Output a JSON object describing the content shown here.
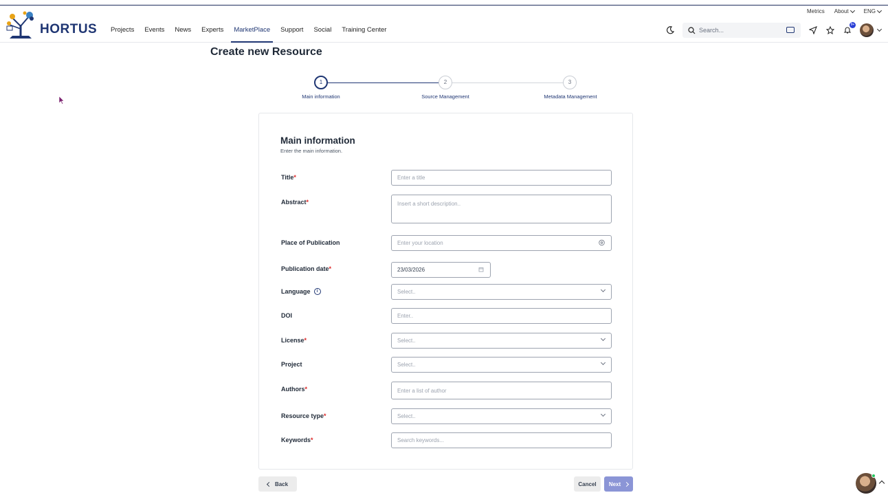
{
  "utility": {
    "metrics": "Metrics",
    "about": "About",
    "lang": "ENG"
  },
  "brand": {
    "name": "HORTUS"
  },
  "nav": {
    "items": [
      "Projects",
      "Events",
      "News",
      "Experts",
      "MarketPlace",
      "Support",
      "Social",
      "Training Center"
    ],
    "active": "MarketPlace"
  },
  "search": {
    "placeholder": "Search..."
  },
  "notifications": {
    "badge": "9+"
  },
  "page": {
    "title": "Create new Resource"
  },
  "stepper": {
    "steps": [
      {
        "number": "1",
        "label": "Main information",
        "active": true
      },
      {
        "number": "2",
        "label": "Source Management",
        "active": false
      },
      {
        "number": "3",
        "label": "Metadata Management",
        "active": false
      }
    ]
  },
  "form": {
    "title": "Main information",
    "subtitle": "Enter the main information.",
    "required_mark": "*",
    "fields": {
      "title": {
        "label": "Title",
        "placeholder": "Enter a title"
      },
      "abstract": {
        "label": "Abstract",
        "placeholder": "Insert a short description.."
      },
      "place": {
        "label": "Place of Publication",
        "placeholder": "Enter your location"
      },
      "date": {
        "label": "Publication date",
        "value": "23/03/2026"
      },
      "language": {
        "label": "Language",
        "placeholder": "Select.."
      },
      "doi": {
        "label": "DOI",
        "placeholder": "Enter.."
      },
      "license": {
        "label": "License",
        "placeholder": "Select.."
      },
      "project": {
        "label": "Project",
        "placeholder": "Select.."
      },
      "authors": {
        "label": "Authors",
        "placeholder": "Enter a list of author"
      },
      "resource_type": {
        "label": "Resource type",
        "placeholder": "Select.."
      },
      "keywords": {
        "label": "Keywords",
        "placeholder": "Search keywords..."
      }
    }
  },
  "footer": {
    "back": "Back",
    "cancel": "Cancel",
    "next": "Next"
  },
  "colors": {
    "brand": "#1f3673",
    "required": "#dc2626",
    "next_button": "#8b95d6"
  }
}
